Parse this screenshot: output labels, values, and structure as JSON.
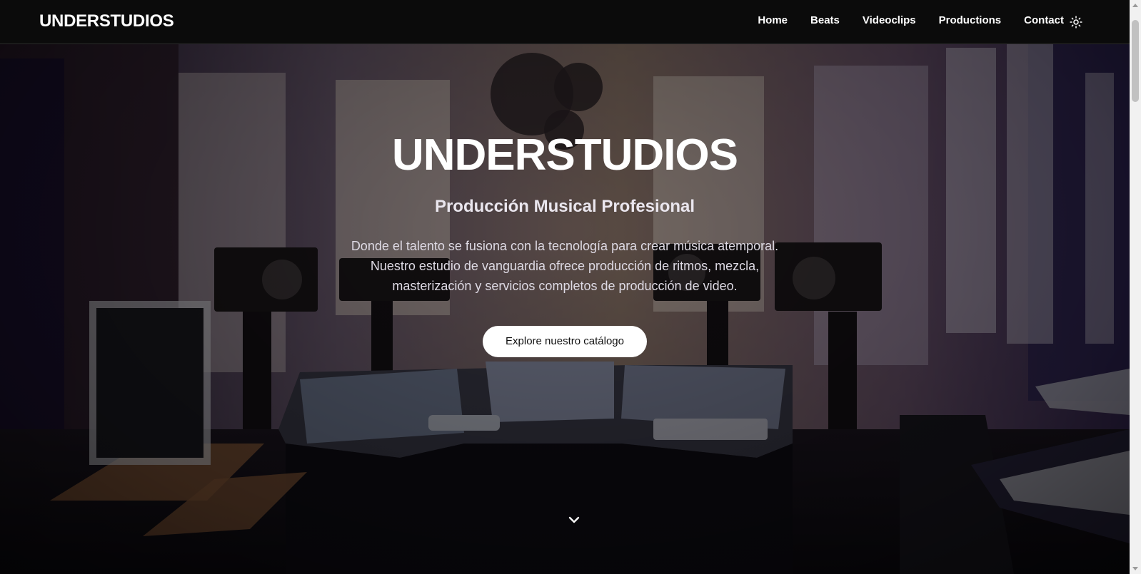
{
  "navbar": {
    "logo": "UNDERSTUDIOS",
    "links": [
      "Home",
      "Beats",
      "Videoclips",
      "Productions",
      "Contact"
    ],
    "theme_icon": "sun-icon"
  },
  "hero": {
    "title": "UNDERSTUDIOS",
    "subtitle": "Producción Musical Profesional",
    "description_lines": [
      "Donde el talento se fusiona con la tecnología para crear música atemporal.",
      "Nuestro estudio de vanguardia ofrece producción de ritmos, mezcla,",
      "masterización y servicios completos de producción de video."
    ],
    "cta_label": "Explore nuestro catálogo",
    "scroll_icon": "chevron-down-icon",
    "background_image": "recording-studio-photo"
  },
  "colors": {
    "navbar_bg": "#0b0b0b",
    "cta_bg": "#ffffff",
    "cta_text": "#111111",
    "accent_purple": "#5a3aa8"
  }
}
